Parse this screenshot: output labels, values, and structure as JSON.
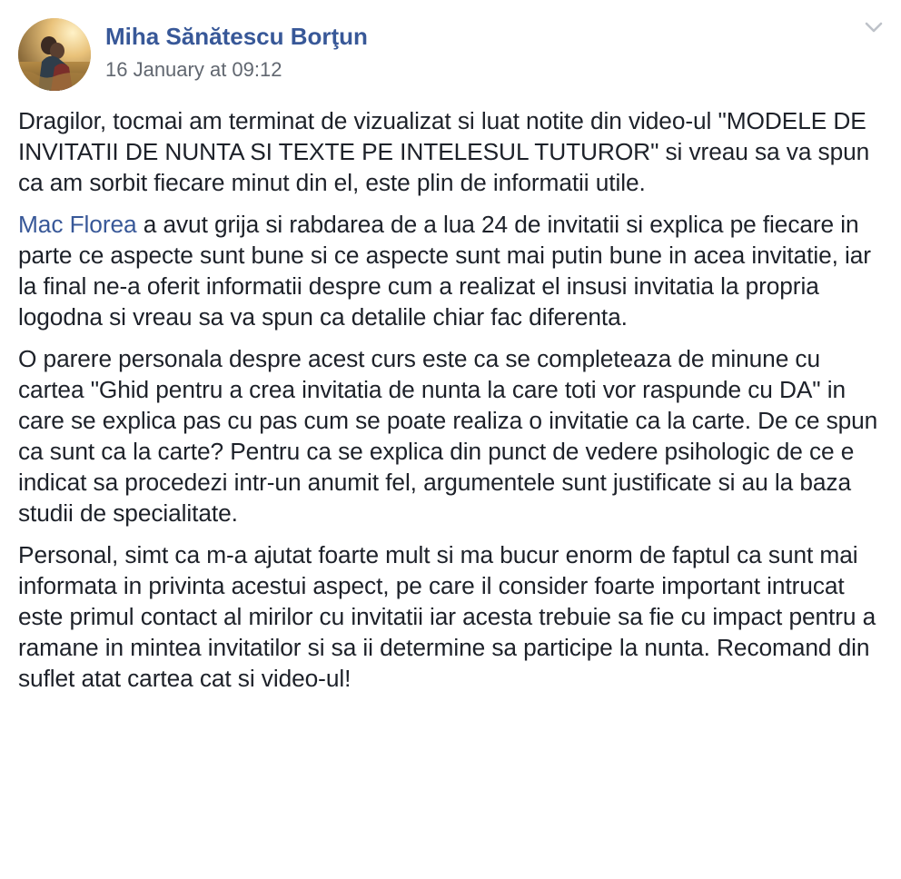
{
  "post": {
    "author": "Miha Sănătescu Borţun",
    "timestamp": "16 January at 09:12",
    "menu_icon": "chevron-down-icon",
    "avatar_icon": "profile-photo",
    "paragraphs": [
      {
        "text": "Dragilor, tocmai am terminat de vizualizat si luat notite din video-ul \"MODELE DE INVITATII DE NUNTA SI TEXTE PE INTELESUL TUTUROR\" si vreau sa va spun ca am sorbit fiecare minut din el, este plin de informatii utile."
      },
      {
        "mention": "Mac Florea",
        "text": " a avut grija si rabdarea de a lua 24 de invitatii si explica pe fiecare in parte ce aspecte sunt bune si ce aspecte sunt mai putin bune in acea invitatie, iar la final ne-a oferit informatii despre cum a realizat el insusi invitatia la propria logodna si vreau sa va spun ca detalile chiar fac diferenta."
      },
      {
        "text": "O parere personala despre acest curs este ca se completeaza de minune cu cartea \"Ghid pentru a crea invitatia de nunta la care toti vor raspunde cu DA\" in care se explica pas cu pas cum se poate realiza o invitatie ca la carte. De ce spun ca sunt ca la carte? Pentru ca se explica din punct de vedere psihologic de ce e indicat sa procedezi intr-un anumit fel, argumentele sunt justificate si au la baza studii de specialitate."
      },
      {
        "text": "Personal, simt ca m-a ajutat foarte mult si ma bucur enorm de faptul ca sunt mai informata in privinta acestui aspect, pe care il consider foarte important intrucat este primul contact al mirilor cu invitatii iar acesta trebuie sa fie cu impact pentru a ramane in mintea invitatilor si sa ii determine sa participe la nunta. Recomand din suflet atat cartea cat si video-ul!"
      }
    ]
  },
  "colors": {
    "link": "#385898",
    "text": "#1d2129",
    "meta": "#616770",
    "chevron": "#bec2c9"
  }
}
